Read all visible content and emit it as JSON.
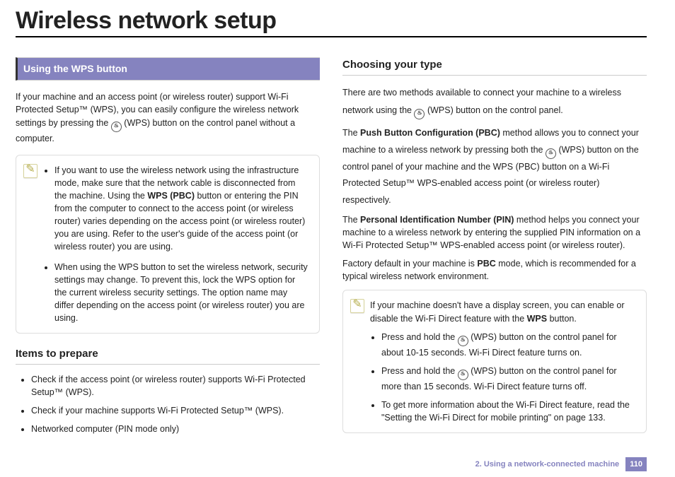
{
  "title": "Wireless network setup",
  "left": {
    "sectionBar": "Using the WPS button",
    "intro1": "If your machine and an access point (or wireless router) support Wi-Fi Protected Setup™ (WPS), you can easily configure the wireless network settings by pressing the ",
    "intro2": " (WPS) button on the control panel without a computer.",
    "note": {
      "bullet1a": "If you want to use the wireless network using the infrastructure mode, make sure that the network cable is disconnected from the machine. Using the ",
      "bullet1b": "WPS (PBC)",
      "bullet1c": " button or entering the PIN from the computer to connect to the access point (or wireless router) varies depending on the access point (or wireless router) you are using. Refer to the user's guide of the access point (or wireless router) you are using.",
      "bullet2": "When using the WPS button to set the wireless network, security settings may change. To prevent this, lock the WPS option for the current wireless security settings. The option name may differ depending on the access point (or wireless router) you are using."
    },
    "itemsHeading": "Items to prepare",
    "items": {
      "i1": "Check if the access point (or wireless router) supports Wi-Fi Protected Setup™ (WPS).",
      "i2": "Check if your machine supports Wi-Fi Protected Setup™ (WPS).",
      "i3": "Networked computer (PIN mode only)"
    }
  },
  "right": {
    "heading": "Choosing your type",
    "p1a": "There are two methods available to connect your machine to a wireless network using the ",
    "p1b": " (WPS) button on the control panel.",
    "p2a": "The ",
    "p2b": "Push Button Configuration (PBC)",
    "p2c": " method allows you to connect your machine to a wireless network by pressing both the ",
    "p2d": " (WPS) button on the control panel of your machine and the WPS (PBC) button on a Wi-Fi Protected Setup™ WPS-enabled access point (or wireless router) respectively.",
    "p3a": "The ",
    "p3b": "Personal Identification Number (PIN)",
    "p3c": " method helps you connect your machine to a wireless network by entering the supplied PIN information on a Wi-Fi Protected Setup™ WPS-enabled access point (or wireless router).",
    "p4a": "Factory default in your machine is ",
    "p4b": "PBC",
    "p4c": " mode, which is recommended for a typical wireless network environment.",
    "note": {
      "intro1": "If your machine doesn't have a display screen, you can enable or disable the Wi-Fi Direct feature with the ",
      "intro2": "WPS",
      "intro3": " button.",
      "b1a": "Press and hold the ",
      "b1b": " (WPS) button on the control panel for about 10-15 seconds. Wi-Fi Direct feature turns on.",
      "b2a": "Press and hold the ",
      "b2b": " (WPS) button on the control panel for more than 15 seconds. Wi-Fi Direct feature turns off.",
      "b3": "To get more information about the Wi-Fi Direct feature, read the \"Setting the Wi-Fi Direct for mobile printing\" on page 133."
    }
  },
  "footer": {
    "chapter": "2.  Using a network-connected machine",
    "page": "110"
  }
}
